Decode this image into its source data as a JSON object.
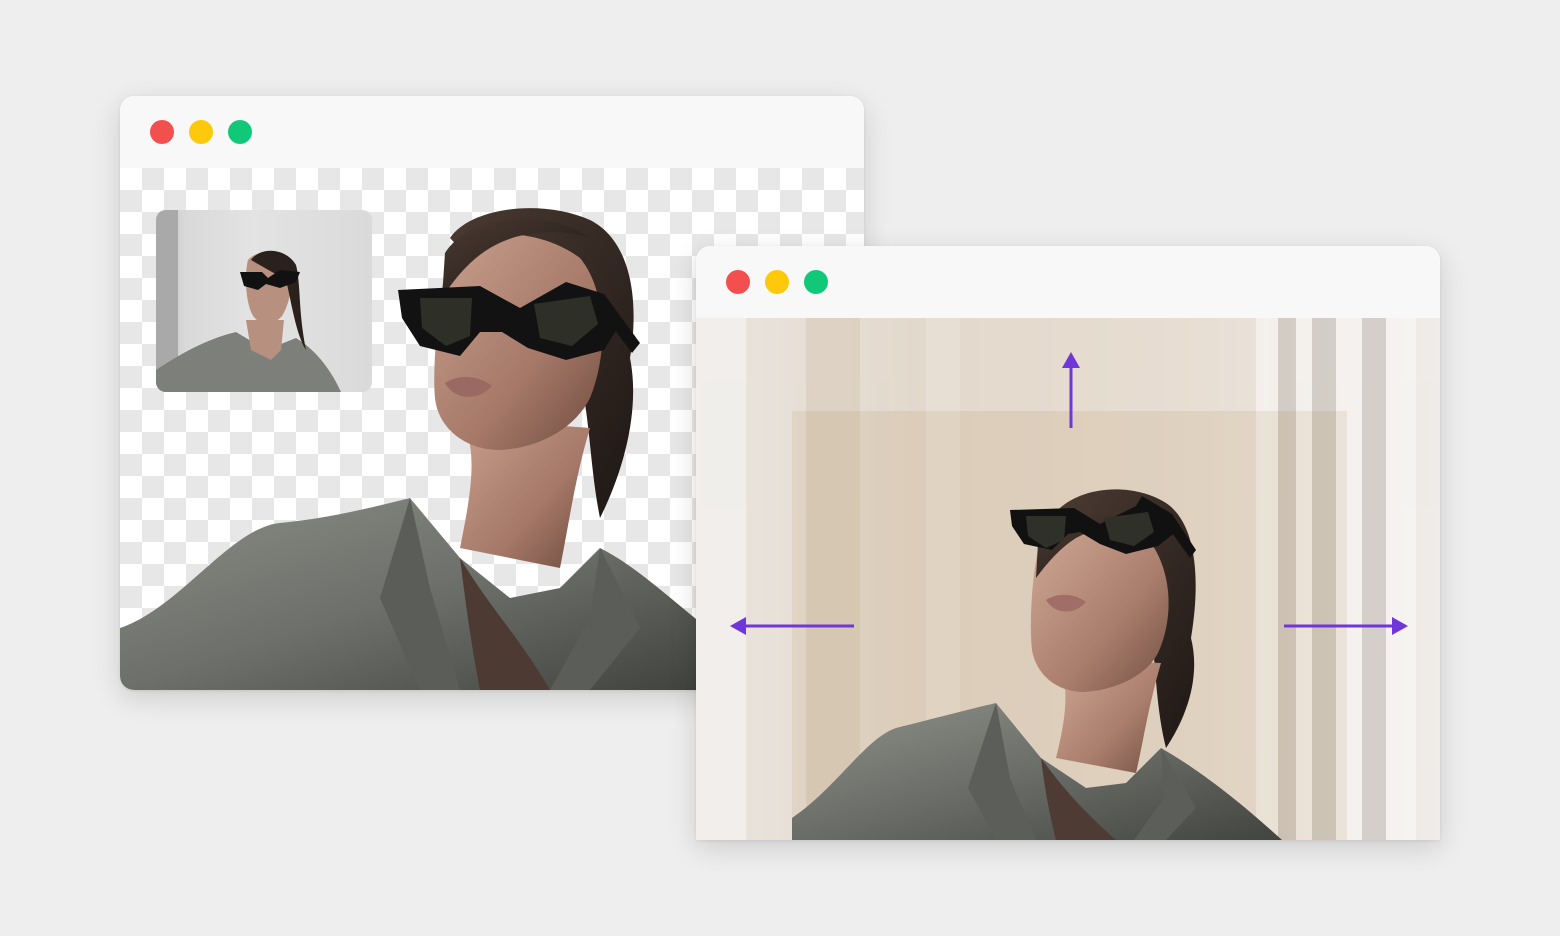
{
  "windows": {
    "left": {
      "controls": [
        "close",
        "minimize",
        "zoom"
      ],
      "canvas": "transparent-background",
      "thumbnail": "original-photo"
    },
    "right": {
      "controls": [
        "close",
        "minimize",
        "zoom"
      ],
      "canvas": "expanded-background",
      "expand_directions": [
        "up",
        "left",
        "right"
      ]
    }
  },
  "colors": {
    "close": "#f44f4f",
    "minimize": "#fdc90a",
    "zoom": "#11c879",
    "arrow": "#6f36d9",
    "page_background": "#eeeeee",
    "window_chrome": "#f8f8f8"
  },
  "icons": [
    "arrow-up-icon",
    "arrow-left-icon",
    "arrow-right-icon"
  ]
}
